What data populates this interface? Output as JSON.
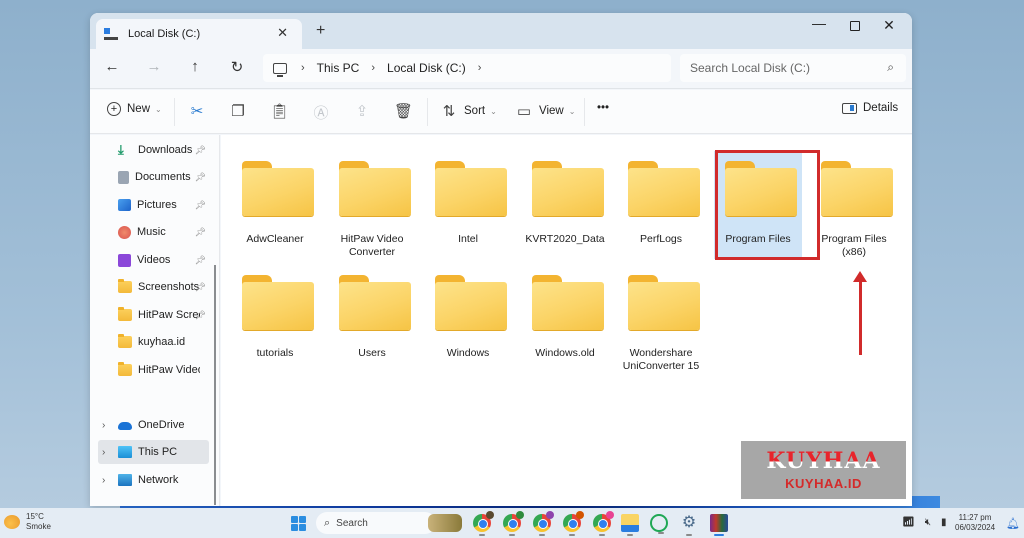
{
  "window": {
    "tab_title": "Local Disk (C:)",
    "new_tab_label": "+",
    "close_tab_label": "✕"
  },
  "navigation": {
    "back": "←",
    "forward": "→",
    "up": "↑",
    "refresh": "↻",
    "breadcrumb": [
      "This PC",
      "Local Disk (C:)"
    ],
    "search_placeholder": "Search Local Disk (C:)"
  },
  "toolbar": {
    "new_label": "New",
    "sort_label": "Sort",
    "view_label": "View",
    "more_label": "•••",
    "details_label": "Details",
    "icons": [
      "cut-icon",
      "copy-icon",
      "paste-icon",
      "rename-icon",
      "share-icon",
      "delete-icon"
    ]
  },
  "sidebar": {
    "quick_access": [
      {
        "label": "Downloads",
        "icon": "download-icon",
        "pinned": true
      },
      {
        "label": "Documents",
        "icon": "documents-icon",
        "pinned": true
      },
      {
        "label": "Pictures",
        "icon": "pictures-icon",
        "pinned": true
      },
      {
        "label": "Music",
        "icon": "music-icon",
        "pinned": true
      },
      {
        "label": "Videos",
        "icon": "videos-icon",
        "pinned": true
      },
      {
        "label": "Screenshots",
        "icon": "folder-icon",
        "pinned": true
      },
      {
        "label": "HitPaw Scree",
        "icon": "folder-icon",
        "pinned": true
      },
      {
        "label": "kuyhaa.id",
        "icon": "folder-icon",
        "pinned": false
      },
      {
        "label": "HitPaw Video Co",
        "icon": "folder-icon",
        "pinned": false
      }
    ],
    "tree": [
      {
        "label": "OneDrive",
        "icon": "onedrive-icon",
        "selected": false
      },
      {
        "label": "This PC",
        "icon": "this-pc-icon",
        "selected": true
      },
      {
        "label": "Network",
        "icon": "network-icon",
        "selected": false
      }
    ]
  },
  "folders": [
    {
      "name": "AdwCleaner"
    },
    {
      "name": "HitPaw Video Converter"
    },
    {
      "name": "Intel"
    },
    {
      "name": "KVRT2020_Data"
    },
    {
      "name": "PerfLogs"
    },
    {
      "name": "Program Files",
      "selected": true
    },
    {
      "name": "Program Files (x86)"
    },
    {
      "name": "tutorials"
    },
    {
      "name": "Users"
    },
    {
      "name": "Windows"
    },
    {
      "name": "Windows.old"
    },
    {
      "name": "Wondershare UniConverter 15"
    }
  ],
  "annotation": {
    "highlight_color": "#d12b2b",
    "highlighted_item": "Program Files"
  },
  "watermark": {
    "big": "KUYHAA",
    "small": "KUYHAA.ID"
  },
  "taskbar": {
    "weather_temp": "15°C",
    "weather_desc": "Smoke",
    "search_label": "Search",
    "time": "11:27 pm",
    "date": "06/03/2024",
    "apps": [
      "widgets-icon",
      "chrome-icon",
      "chrome-icon",
      "chrome-icon",
      "chrome-icon",
      "chrome-icon",
      "file-explorer-icon",
      "whatsapp-icon",
      "settings-icon",
      "winrar-icon"
    ]
  }
}
